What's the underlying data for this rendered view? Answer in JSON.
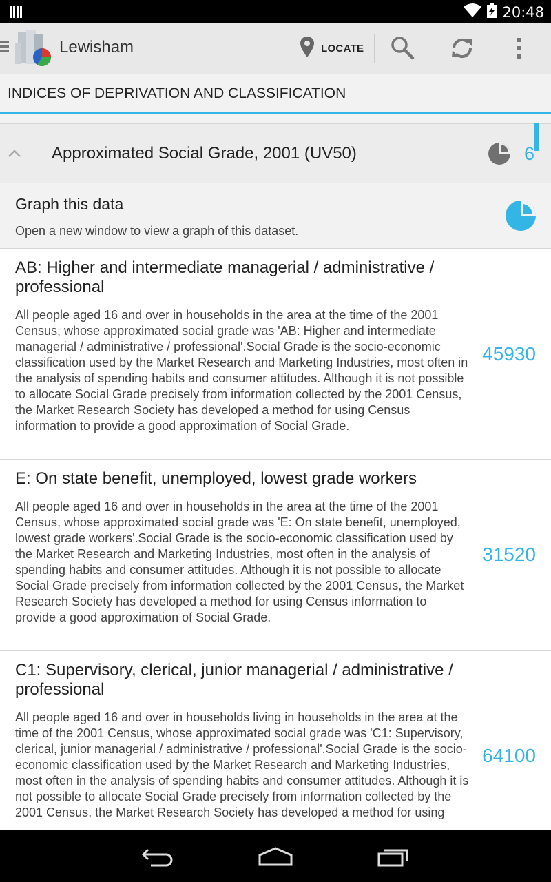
{
  "status_bar": {
    "time": "20:48",
    "icons": [
      "notification-bars-icon",
      "wifi-icon",
      "battery-charging-icon"
    ]
  },
  "action_bar": {
    "title": "Lewisham",
    "locate_label": "LOCATE",
    "icons": [
      "drawer-icon",
      "app-logo-icon",
      "location-pin-icon",
      "search-icon",
      "refresh-icon",
      "overflow-menu-icon"
    ]
  },
  "section": {
    "title": "INDICES OF DEPRIVATION AND CLASSIFICATION"
  },
  "group": {
    "title": "Approximated Social Grade, 2001 (UV50)",
    "count": "6"
  },
  "graph": {
    "title": "Graph this data",
    "subtitle": "Open a new window to view a graph of this dataset."
  },
  "items": [
    {
      "name": "AB:  Higher and intermediate managerial / administrative / professional",
      "description": "All people aged 16 and over in households in the area at the time of the 2001 Census, whose approximated social grade was 'AB: Higher and intermediate managerial / administrative / professional'.Social Grade is the socio-economic classification used by the Market Research and Marketing Industries, most often in the analysis of spending habits and consumer attitudes.  Although it is not possible to allocate Social Grade precisely from information collected by the 2001 Census, the Market Research Society has developed a method for using Census information to provide a good approximation of Social Grade.",
      "value": "45930"
    },
    {
      "name": "E:   On state benefit, unemployed, lowest grade workers",
      "description": "All people aged 16 and over in households in the area at the time of the 2001 Census, whose approximated social grade was 'E: On state benefit, unemployed, lowest grade workers'.Social Grade is the socio-economic classification used by the Market Research and Marketing Industries, most often in the analysis of spending habits and consumer attitudes.  Although it is not possible to allocate Social Grade precisely from information collected by the 2001 Census, the Market Research Society has developed a method for using Census information to provide a good approximation of Social Grade.",
      "value": "31520"
    },
    {
      "name": "C1:  Supervisory,  clerical,  junior managerial / administrative / professional",
      "description": "All people aged 16 and over in households living in households in the area at the time of the 2001 Census, whose approximated social grade was 'C1: Supervisory, clerical, junior managerial / administrative / professional'.Social Grade is the socio-economic classification used by the Market Research and Marketing Industries, most often in the analysis of spending habits and consumer attitudes.  Although it is not possible to allocate Social Grade precisely from information collected by the 2001 Census, the Market Research Society has developed a method for using",
      "value": "64100"
    }
  ],
  "nav_bar": {
    "icons": [
      "back-icon",
      "home-icon",
      "recent-apps-icon"
    ]
  },
  "colors": {
    "accent": "#33b5e5",
    "status_bar": "#000000",
    "action_bar": "#e8e8e8"
  }
}
